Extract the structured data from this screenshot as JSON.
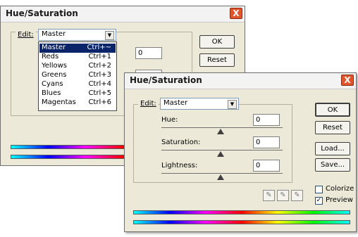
{
  "back_dialog": {
    "title": "Hue/Saturation",
    "close_glyph": "X",
    "edit_label": "Edit:",
    "edit_value": "Master",
    "hue_value": "0",
    "ok_label": "OK",
    "reset_label": "Reset",
    "menu_items": [
      {
        "name": "Master",
        "shortcut": "Ctrl+~"
      },
      {
        "name": "Reds",
        "shortcut": "Ctrl+1"
      },
      {
        "name": "Yellows",
        "shortcut": "Ctrl+2"
      },
      {
        "name": "Greens",
        "shortcut": "Ctrl+3"
      },
      {
        "name": "Cyans",
        "shortcut": "Ctrl+4"
      },
      {
        "name": "Blues",
        "shortcut": "Ctrl+5"
      },
      {
        "name": "Magentas",
        "shortcut": "Ctrl+6"
      }
    ]
  },
  "front_dialog": {
    "title": "Hue/Saturation",
    "close_glyph": "X",
    "edit_label": "Edit:",
    "edit_value": "Master",
    "hue_label": "Hue:",
    "hue_value": "0",
    "saturation_label": "Saturation:",
    "saturation_value": "0",
    "lightness_label": "Lightness:",
    "lightness_value": "0",
    "ok_label": "OK",
    "reset_label": "Reset",
    "load_label": "Load...",
    "save_label": "Save...",
    "colorize_label": "Colorize",
    "preview_label": "Preview",
    "colorize_checked": false,
    "preview_checked": true
  },
  "icons": {
    "dropdown_arrow": "chevron-down-icon",
    "eyedropper": "eyedropper-icon",
    "eyedropper_plus": "eyedropper-plus-icon",
    "eyedropper_minus": "eyedropper-minus-icon",
    "check": "checkmark-icon"
  },
  "colors": {
    "menu_highlight": "#0a246a",
    "close_button": "#e2542b",
    "dialog_face": "#ece9d8"
  }
}
